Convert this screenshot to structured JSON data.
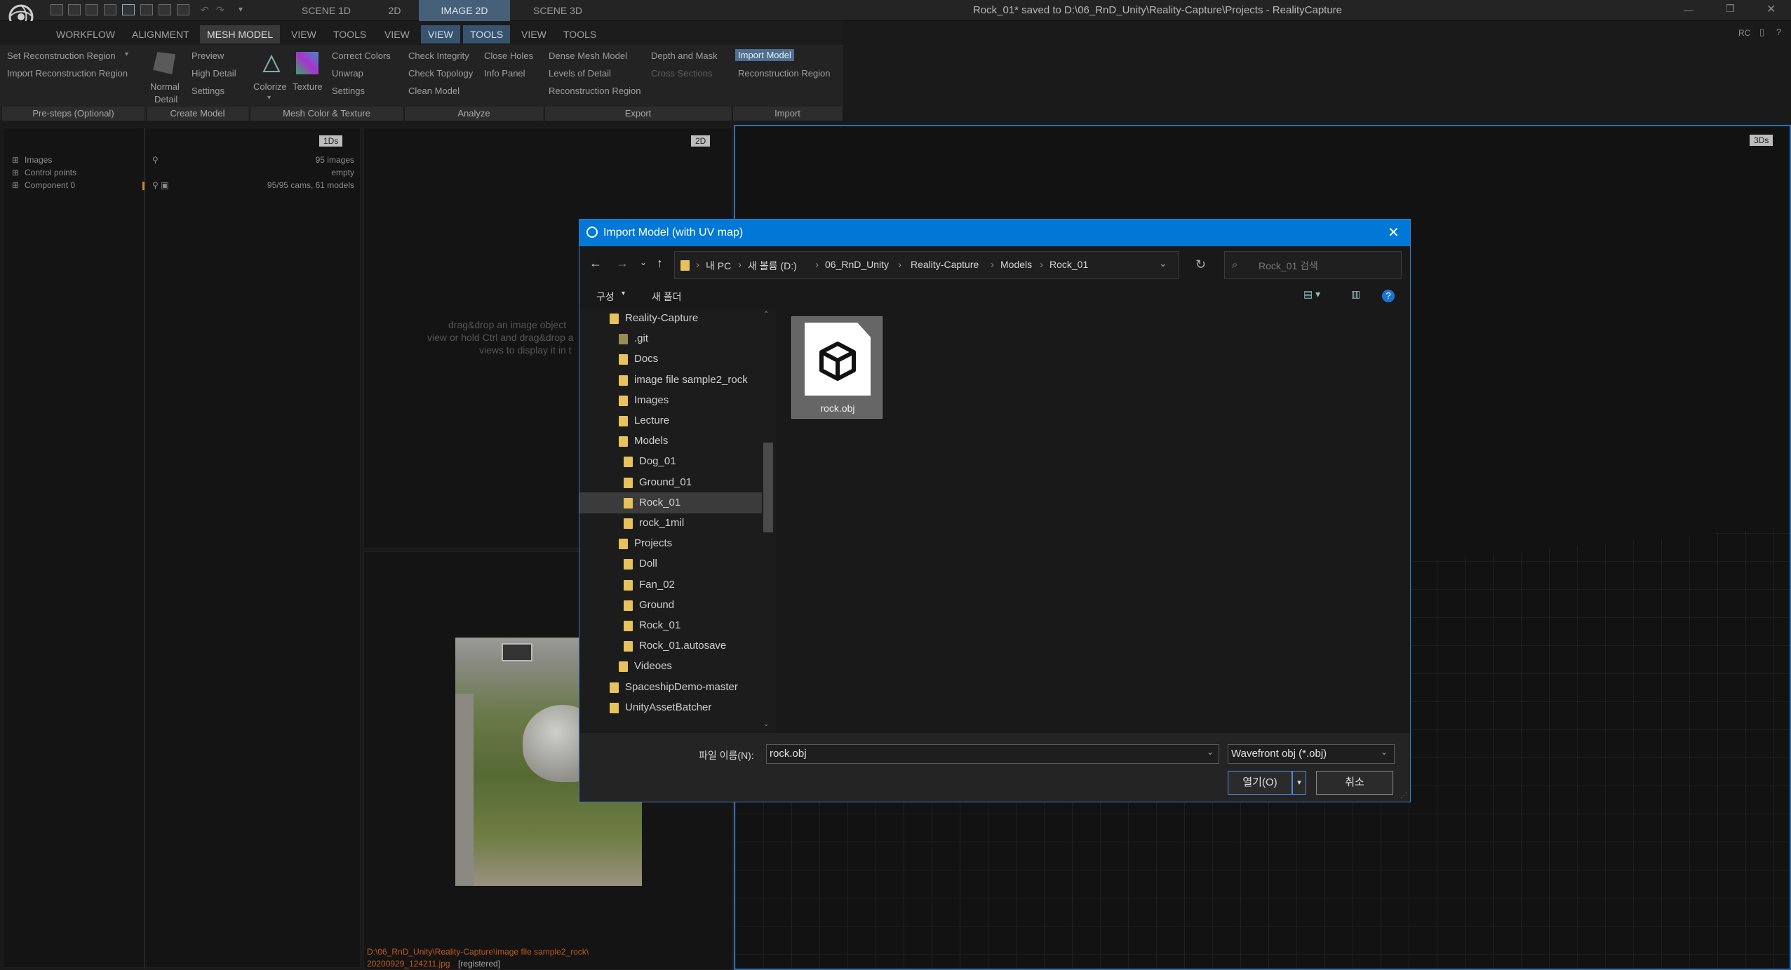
{
  "window": {
    "title": "Rock_01* saved to D:\\06_RnD_Unity\\Reality-Capture\\Projects - RealityCapture",
    "view_tabs": [
      "SCENE 1D",
      "2D",
      "IMAGE 2D",
      "SCENE 3D"
    ],
    "corner_label": "RC"
  },
  "menu": {
    "tabs": [
      "WORKFLOW",
      "ALIGNMENT",
      "MESH MODEL",
      "VIEW",
      "TOOLS",
      "VIEW",
      "VIEW",
      "TOOLS",
      "VIEW",
      "TOOLS"
    ]
  },
  "ribbon": {
    "presteps": {
      "a": "Set Reconstruction Region",
      "b": "Import Reconstruction Region",
      "group": "Pre-steps (Optional)"
    },
    "create": {
      "normal": "Normal",
      "detail": "Detail",
      "preview": "Preview",
      "high": "High Detail",
      "settings": "Settings",
      "group": "Create Model"
    },
    "color": {
      "colorize": "Colorize",
      "texture": "Texture",
      "correct": "Correct Colors",
      "unwrap": "Unwrap",
      "settings": "Settings",
      "group": "Mesh Color & Texture"
    },
    "analyze": {
      "integrity": "Check Integrity",
      "topology": "Check Topology",
      "clean": "Clean Model",
      "close": "Close Holes",
      "info": "Info Panel",
      "group": "Analyze"
    },
    "export": {
      "dense": "Dense Mesh Model",
      "lod": "Levels of Detail",
      "region": "Reconstruction Region",
      "depth": "Depth and Mask",
      "cross": "Cross Sections",
      "group": "Export"
    },
    "import": {
      "model": "Import Model",
      "region": "Reconstruction Region",
      "group": "Import"
    }
  },
  "panels": {
    "tag_1ds": "1Ds",
    "tag_2d": "2D",
    "tag_3ds": "3Ds",
    "tree": [
      {
        "label": "Images",
        "value": "95 images"
      },
      {
        "label": "Control points",
        "value": "empty"
      },
      {
        "label": "Component 0",
        "value": "95/95 cams, 61 models"
      }
    ],
    "hint_lines": [
      "drag&drop an image object",
      "view or hold Ctrl and drag&drop a",
      "views to display it in t"
    ],
    "image_path": "D:\\06_RnD_Unity\\Reality-Capture\\image file sample2_rock\\",
    "image_file": "20200929_124211.jpg",
    "image_status": "[registered]"
  },
  "dialog": {
    "title": "Import Model (with UV map)",
    "breadcrumb": [
      "내 PC",
      "새 볼륨 (D:)",
      "06_RnD_Unity",
      "Reality-Capture",
      "Models",
      "Rock_01"
    ],
    "search_placeholder": "Rock_01 검색",
    "organize": "구성",
    "new_folder": "새 폴더",
    "tree": [
      {
        "label": "Reality-Capture",
        "level": 0
      },
      {
        "label": ".git",
        "level": 1
      },
      {
        "label": "Docs",
        "level": 1
      },
      {
        "label": "image file sample2_rock",
        "level": 1
      },
      {
        "label": "Images",
        "level": 1
      },
      {
        "label": "Lecture",
        "level": 1
      },
      {
        "label": "Models",
        "level": 1
      },
      {
        "label": "Dog_01",
        "level": 2
      },
      {
        "label": "Ground_01",
        "level": 2
      },
      {
        "label": "Rock_01",
        "level": 2,
        "selected": true
      },
      {
        "label": "rock_1mil",
        "level": 2
      },
      {
        "label": "Projects",
        "level": 1
      },
      {
        "label": "Doll",
        "level": 2
      },
      {
        "label": "Fan_02",
        "level": 2
      },
      {
        "label": "Ground",
        "level": 2
      },
      {
        "label": "Rock_01",
        "level": 2
      },
      {
        "label": "Rock_01.autosave",
        "level": 2
      },
      {
        "label": "Videoes",
        "level": 1
      },
      {
        "label": "SpaceshipDemo-master",
        "level": 0
      },
      {
        "label": "UnityAssetBatcher",
        "level": 0
      }
    ],
    "file": {
      "name": "rock.obj",
      "icon": "3d-object-icon"
    },
    "filename_label": "파일 이름(N):",
    "filename_value": "rock.obj",
    "filetype_value": "Wavefront obj (*.obj)",
    "open_button": "열기(O)",
    "cancel_button": "취소"
  },
  "colors": {
    "accent": "#0078d7",
    "context_tab": "#38536d",
    "folder": "#e8c25a"
  }
}
